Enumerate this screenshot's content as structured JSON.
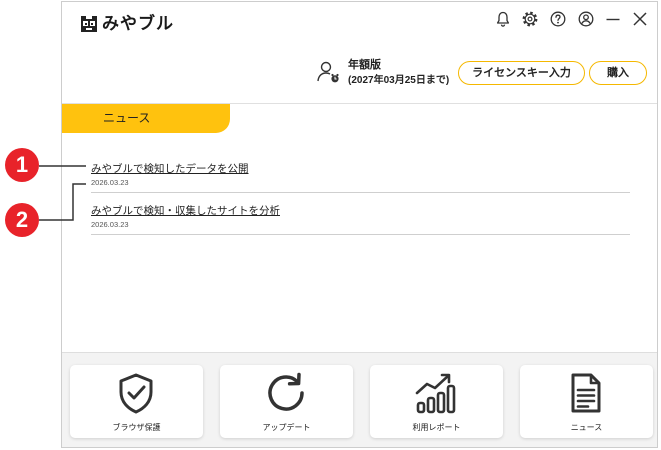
{
  "app": {
    "title": "みやブル",
    "logo_icon": "panda-logo-icon"
  },
  "window_controls": {
    "icons": [
      "bell-icon",
      "gear-icon",
      "help-icon",
      "account-icon",
      "minimize-icon",
      "close-icon"
    ]
  },
  "license": {
    "user_icon": "user-clock-icon",
    "plan": "年額版",
    "expiry": "(2027年03月25日まで)",
    "license_key_button": "ライセンスキー入力",
    "purchase_button": "購入"
  },
  "news": {
    "tab_label": "ニュース",
    "items": [
      {
        "title": "みやブルで検知したデータを公開",
        "date": "2026.03.23"
      },
      {
        "title": "みやブルで検知・収集したサイトを分析",
        "date": "2026.03.23"
      }
    ]
  },
  "footer": {
    "items": [
      {
        "label": "ブラウザ保護",
        "icon": "shield-check-icon"
      },
      {
        "label": "アップデート",
        "icon": "refresh-icon"
      },
      {
        "label": "利用レポート",
        "icon": "bar-chart-icon"
      },
      {
        "label": "ニュース",
        "icon": "document-icon"
      }
    ]
  },
  "callouts": [
    "1",
    "2"
  ],
  "colors": {
    "accent": "#FFC20E",
    "button_border": "#F5B800",
    "callout": "#E8232A",
    "text": "#222222",
    "footer_bg": "#F3F3F3"
  }
}
